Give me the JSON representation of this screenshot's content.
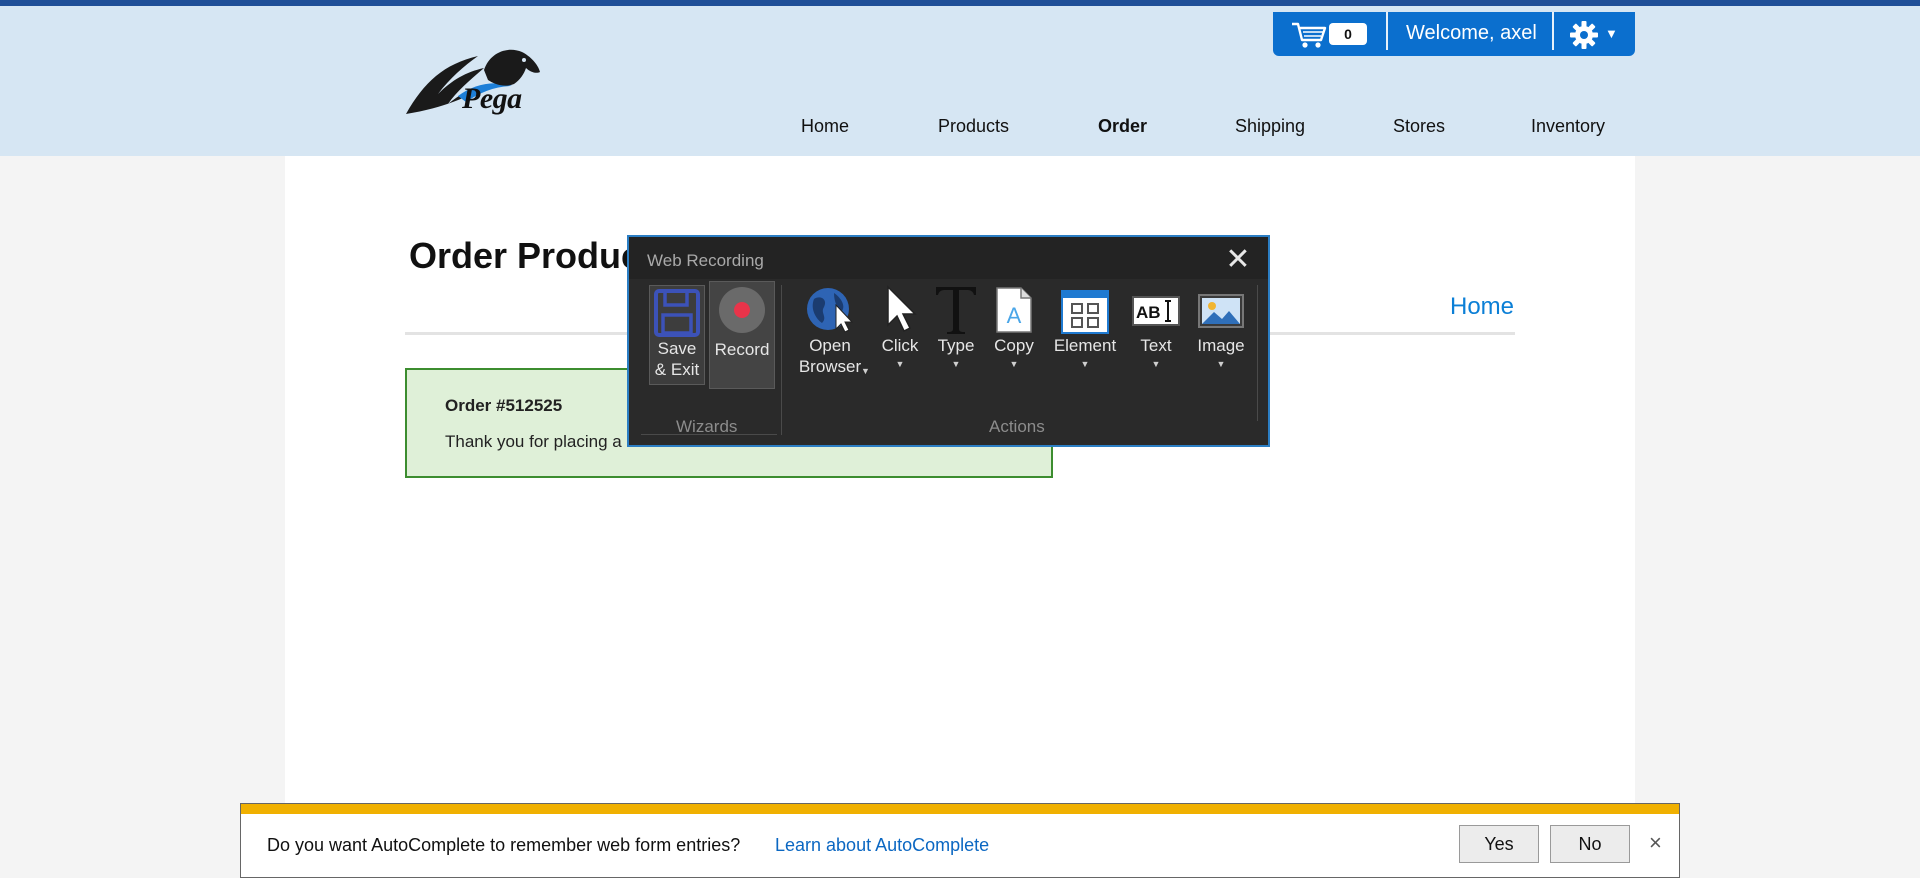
{
  "header": {
    "logo_text": "Pega",
    "cart_count": "0",
    "welcome": "Welcome, axel",
    "nav": [
      {
        "label": "Home",
        "active": false
      },
      {
        "label": "Products",
        "active": false
      },
      {
        "label": "Order",
        "active": true
      },
      {
        "label": "Shipping",
        "active": false
      },
      {
        "label": "Stores",
        "active": false
      },
      {
        "label": "Inventory",
        "active": false
      }
    ]
  },
  "page": {
    "title": "Order Produc",
    "home_link": "Home",
    "order": {
      "number": "Order #512525",
      "message": "Thank you for placing a"
    }
  },
  "recorder": {
    "title": "Web Recording",
    "wizards": {
      "label": "Wizards",
      "save_line1": "Save",
      "save_line2": "& Exit",
      "record": "Record"
    },
    "actions": {
      "label": "Actions",
      "open_line1": "Open",
      "open_line2": "Browser",
      "click": "Click",
      "type": "Type",
      "copy": "Copy",
      "element": "Element",
      "text": "Text",
      "image": "Image"
    }
  },
  "autocomplete": {
    "question": "Do you want AutoComplete to remember web form entries?",
    "link": "Learn about AutoComplete",
    "yes": "Yes",
    "no": "No",
    "close": "×"
  },
  "colors": {
    "header_bg": "#d6e6f3",
    "userbar": "#0b6fce",
    "order_box_bg": "#dff0d8",
    "order_box_border": "#3c8d2f",
    "recorder_bg": "#2a2a2a",
    "record_dot": "#e8344a",
    "ac_strip": "#f0b000",
    "link": "#0b7fd6"
  }
}
